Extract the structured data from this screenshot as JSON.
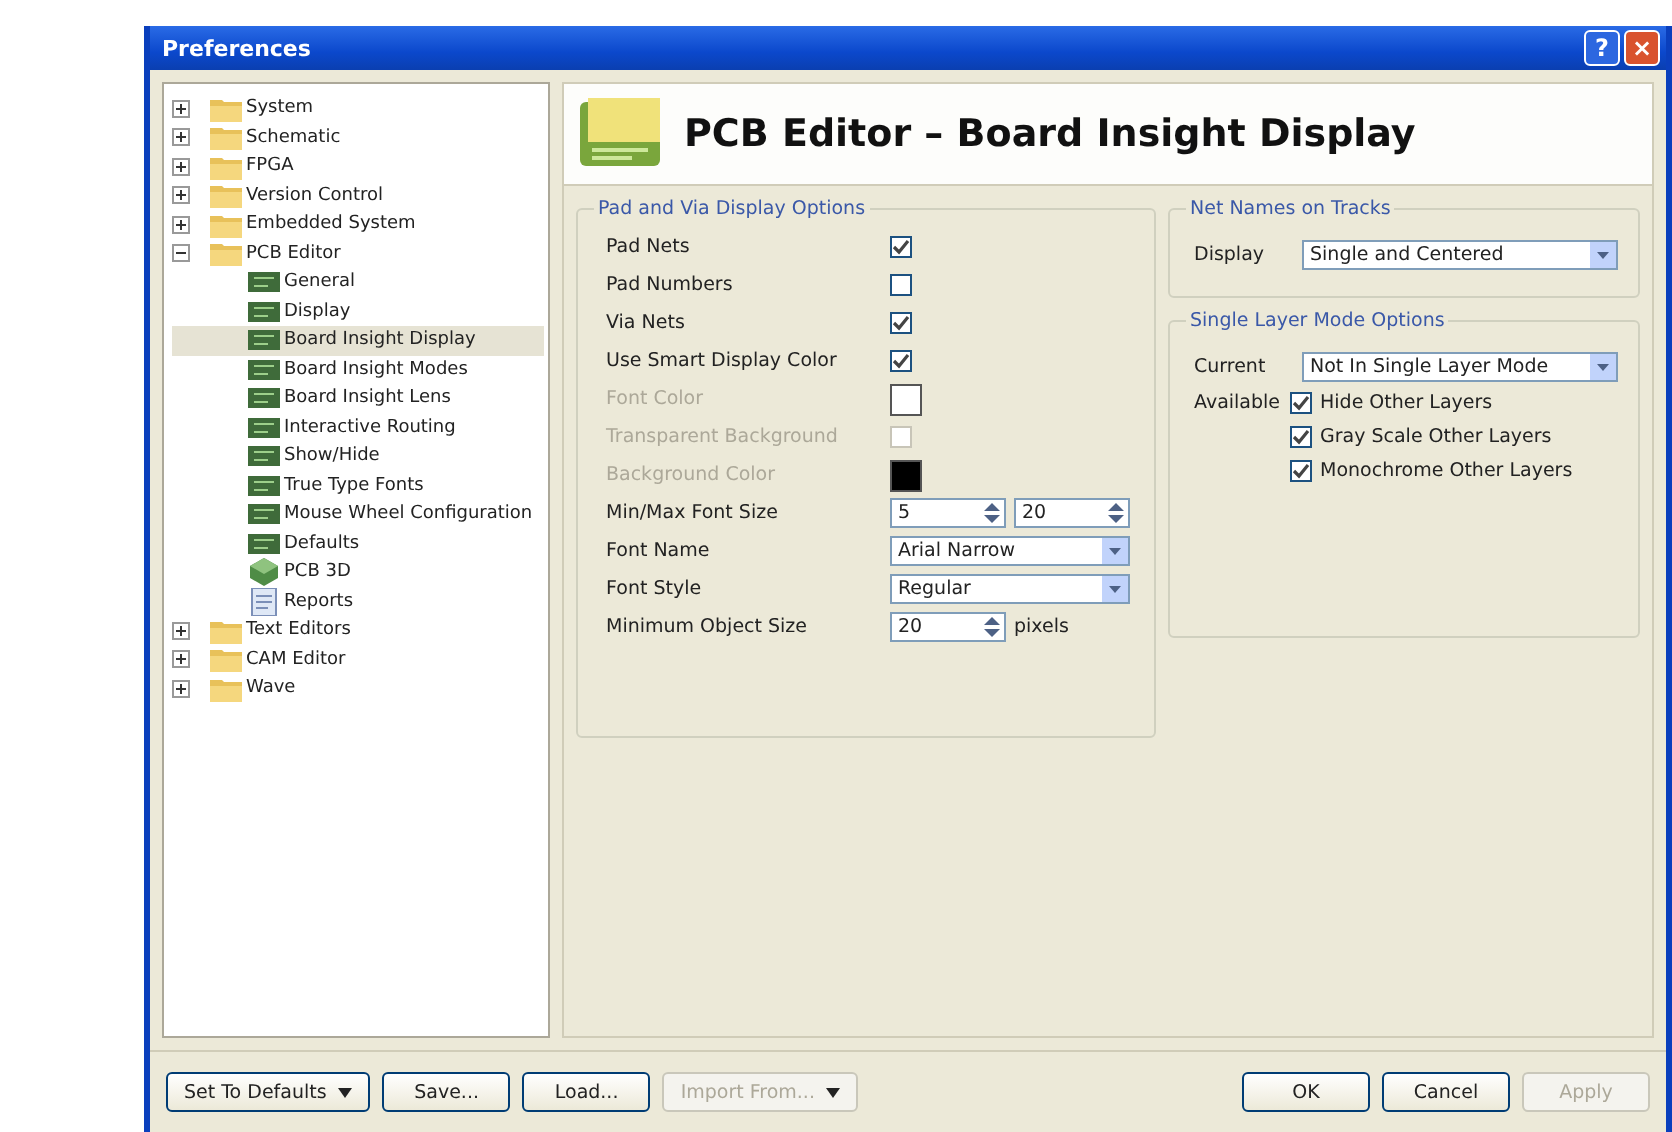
{
  "window": {
    "title": "Preferences",
    "help": "?",
    "close": "×"
  },
  "tree": [
    {
      "label": "System",
      "kind": "folder",
      "expanded": false,
      "selected": false
    },
    {
      "label": "Schematic",
      "kind": "folder",
      "expanded": false,
      "selected": false
    },
    {
      "label": "FPGA",
      "kind": "folder",
      "expanded": false,
      "selected": false
    },
    {
      "label": "Version Control",
      "kind": "folder",
      "expanded": false,
      "selected": false
    },
    {
      "label": "Embedded System",
      "kind": "folder",
      "expanded": false,
      "selected": false
    },
    {
      "label": "PCB Editor",
      "kind": "folder",
      "expanded": true,
      "selected": false,
      "children": [
        {
          "label": "General",
          "kind": "page",
          "selected": false
        },
        {
          "label": "Display",
          "kind": "page",
          "selected": false
        },
        {
          "label": "Board Insight Display",
          "kind": "page",
          "selected": true
        },
        {
          "label": "Board Insight Modes",
          "kind": "page",
          "selected": false
        },
        {
          "label": "Board Insight Lens",
          "kind": "page",
          "selected": false
        },
        {
          "label": "Interactive Routing",
          "kind": "page",
          "selected": false
        },
        {
          "label": "Show/Hide",
          "kind": "page",
          "selected": false
        },
        {
          "label": "True Type Fonts",
          "kind": "page",
          "selected": false
        },
        {
          "label": "Mouse Wheel Configuration",
          "kind": "page",
          "selected": false
        },
        {
          "label": "Defaults",
          "kind": "page",
          "selected": false
        },
        {
          "label": "PCB 3D",
          "kind": "page3d",
          "selected": false
        },
        {
          "label": "Reports",
          "kind": "report",
          "selected": false
        }
      ]
    },
    {
      "label": "Text Editors",
      "kind": "folder",
      "expanded": false,
      "selected": false
    },
    {
      "label": "CAM Editor",
      "kind": "folder",
      "expanded": false,
      "selected": false
    },
    {
      "label": "Wave",
      "kind": "folder",
      "expanded": false,
      "selected": false
    }
  ],
  "page_title": "PCB Editor – Board Insight Display",
  "pad_via_group": {
    "title": "Pad and Via Display Options",
    "rows": [
      {
        "kind": "checkbox",
        "label": "Pad Nets",
        "checked": true,
        "disabled": false
      },
      {
        "kind": "checkbox",
        "label": "Pad Numbers",
        "checked": false,
        "disabled": false
      },
      {
        "kind": "checkbox",
        "label": "Via Nets",
        "checked": true,
        "disabled": false
      },
      {
        "kind": "checkbox",
        "label": "Use Smart Display Color",
        "checked": true,
        "disabled": false
      },
      {
        "kind": "color",
        "label": "Font Color",
        "color": "#ffffff",
        "disabled": true
      },
      {
        "kind": "checkbox",
        "label": "Transparent Background",
        "checked": false,
        "disabled": true
      },
      {
        "kind": "color",
        "label": "Background Color",
        "color": "#000000",
        "disabled": true
      },
      {
        "kind": "spinpair",
        "label": "Min/Max Font Size",
        "value": "5",
        "value2": "20",
        "disabled": false
      },
      {
        "kind": "dropdown",
        "label": "Font Name",
        "value": "Arial Narrow",
        "disabled": false
      },
      {
        "kind": "dropdown",
        "label": "Font Style",
        "value": "Regular",
        "disabled": false
      },
      {
        "kind": "spin",
        "label": "Minimum Object Size",
        "value": "20",
        "unit": "pixels",
        "disabled": false
      }
    ]
  },
  "net_names_group": {
    "title": "Net Names on Tracks",
    "display_label": "Display",
    "display_value": "Single and Centered"
  },
  "single_layer_group": {
    "title": "Single Layer Mode Options",
    "current_label": "Current",
    "current_value": "Not In Single Layer Mode",
    "available_label": "Available",
    "options": [
      {
        "label": "Hide Other Layers",
        "checked": true
      },
      {
        "label": "Gray Scale Other Layers",
        "checked": true
      },
      {
        "label": "Monochrome Other Layers",
        "checked": true
      }
    ]
  },
  "left_buttons": [
    {
      "label": "Set To Defaults",
      "dropdown": true,
      "disabled": false
    },
    {
      "label": "Save...",
      "dropdown": false,
      "disabled": false
    },
    {
      "label": "Load...",
      "dropdown": false,
      "disabled": false
    },
    {
      "label": "Import From...",
      "dropdown": true,
      "disabled": true
    }
  ],
  "right_buttons": [
    {
      "label": "OK",
      "disabled": false
    },
    {
      "label": "Cancel",
      "disabled": false
    },
    {
      "label": "Apply",
      "disabled": true
    }
  ]
}
